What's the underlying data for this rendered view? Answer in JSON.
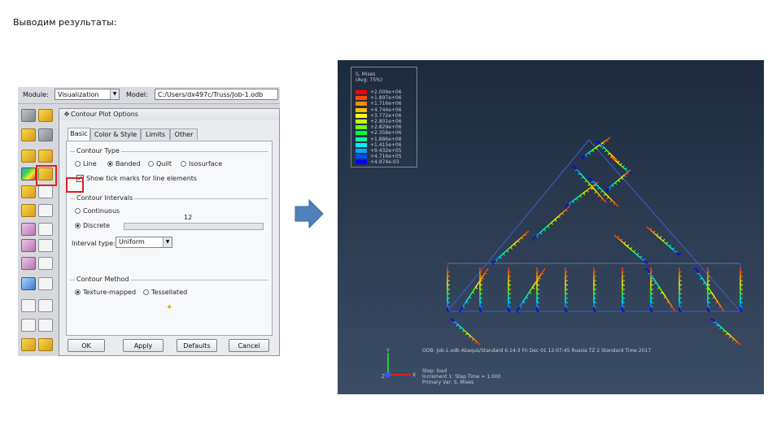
{
  "slide": {
    "title": "Выводим результаты:"
  },
  "colors": {
    "highlight": "#e02020",
    "arrow": "#4f81bd",
    "viewport_bg": "#2a394f"
  },
  "module_bar": {
    "module_label": "Module:",
    "module_value": "Visualization",
    "model_label": "Model:",
    "model_value": "C:/Users/dx497c/Truss/Job-1.odb"
  },
  "toolbox": {
    "icons": [
      "contour-plot-icon",
      "deformed-shape-icon",
      "undeformed-shape-icon",
      "symbol-plot-icon",
      "material-orientation-icon",
      "xy-plot-icon",
      "query-icon",
      "free-body-icon",
      "animate-icon"
    ]
  },
  "dialog": {
    "title": "Contour Plot Options",
    "tabs": [
      "Basic",
      "Color & Style",
      "Limits",
      "Other"
    ],
    "contour_type": {
      "title": "Contour Type",
      "options": [
        "Line",
        "Banded",
        "Quilt",
        "Isosurface"
      ],
      "selected": "Banded",
      "tick_label": "Show tick marks for line elements",
      "tick_checked": true
    },
    "intervals": {
      "title": "Contour Intervals",
      "continuous": "Continuous",
      "discrete": "Discrete",
      "selected": "Discrete",
      "count": "12",
      "interval_type_label": "Interval type:",
      "interval_type_value": "Uniform"
    },
    "method": {
      "title": "Contour Method",
      "options": [
        "Texture-mapped",
        "Tessellated"
      ],
      "selected": "Texture-mapped"
    },
    "buttons": {
      "ok": "OK",
      "apply": "Apply",
      "defaults": "Defaults",
      "cancel": "Cancel"
    }
  },
  "viewport": {
    "legend_title": "S, Mises",
    "legend_avg": "(Avg: 75%)",
    "legend_values": [
      "+2.009e+06",
      "+1.897e+06",
      "+1.716e+06",
      "+4.744e+06",
      "+3.772e+06",
      "+2.801e+06",
      "+2.829e+06",
      "+2.358e+06",
      "+1.886e+06",
      "+1.415e+06",
      "+9.432e+05",
      "+4.716e+05",
      "+4.974e-03"
    ],
    "legend_colors": [
      "#ff0000",
      "#ff4a00",
      "#ff8c00",
      "#ffc000",
      "#ffff00",
      "#c6ff00",
      "#6bff00",
      "#00ff3a",
      "#00ff9c",
      "#00f0ff",
      "#00a8ff",
      "#0050ff",
      "#0000ff"
    ],
    "odb_line": "ODB: Job-1.odb    Abaqus/Standard 6.14-3    Fri Dec 01 12:07:45 Russia TZ 2 Standard Time 2017",
    "step_line": "Step: load",
    "increment_line": "Increment    1: Step Time =    1.000",
    "primary_var_line": "Primary Var: S, Mises",
    "triad_y": "Y",
    "triad_x": "X",
    "triad_z": "Z"
  }
}
